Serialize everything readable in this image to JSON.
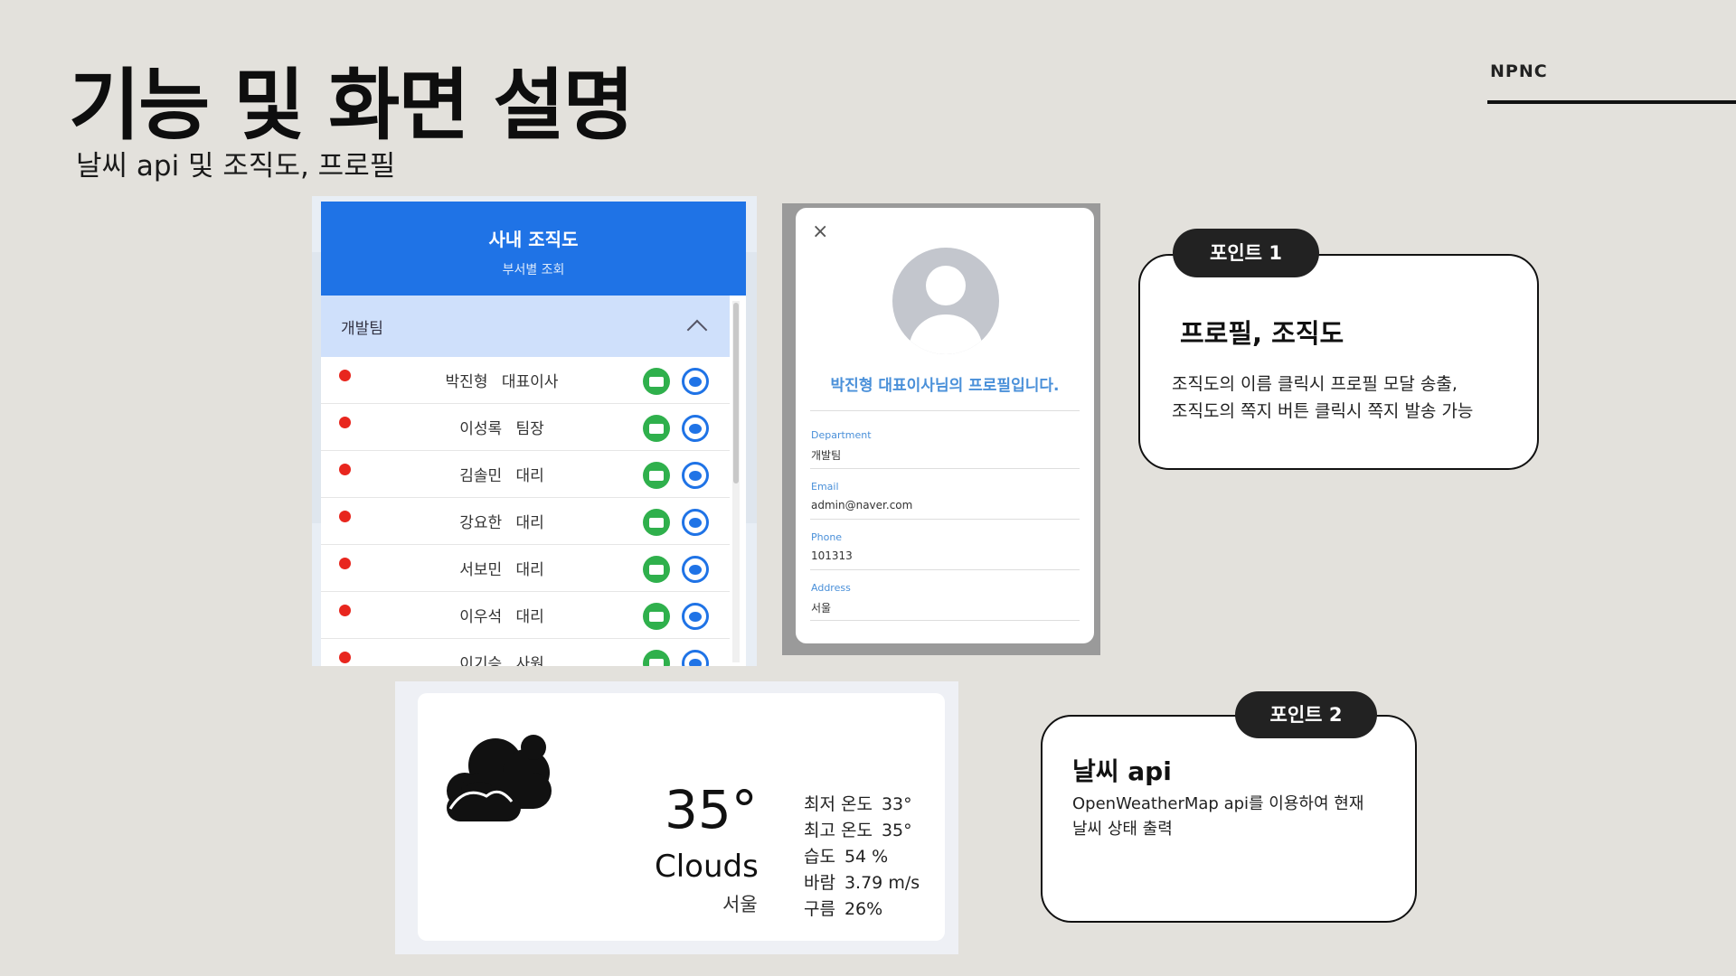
{
  "header": {
    "title": "기능 및 화면 설명",
    "subtitle": "날씨 api 및 조직도, 프로필",
    "brand": "NPNC"
  },
  "org_chart": {
    "title": "사내 조직도",
    "subtitle": "부서별 조회",
    "group_name": "개발팀",
    "members": [
      {
        "name": "박진형",
        "role": "대표이사"
      },
      {
        "name": "이성록",
        "role": "팀장"
      },
      {
        "name": "김솔민",
        "role": "대리"
      },
      {
        "name": "강요한",
        "role": "대리"
      },
      {
        "name": "서보민",
        "role": "대리"
      },
      {
        "name": "이우석",
        "role": "대리"
      },
      {
        "name": "이기승",
        "role": "사원"
      }
    ]
  },
  "profile": {
    "close": "×",
    "heading": "박진형 대표이사님의 프로필입니다.",
    "department_label": "Department",
    "department_value": "개발팀",
    "email_label": "Email",
    "email_value": "admin@naver.com",
    "phone_label": "Phone",
    "phone_value": "101313",
    "address_label": "Address",
    "address_value": "서울"
  },
  "weather": {
    "icon": "cloud-icon",
    "temp": "35°",
    "condition": "Clouds",
    "city": "서울",
    "stats": [
      {
        "label": "최저 온도",
        "value": "33°"
      },
      {
        "label": "최고 온도",
        "value": "35°"
      },
      {
        "label": "습도",
        "value": "54 %"
      },
      {
        "label": "바람",
        "value": "3.79 m/s"
      },
      {
        "label": "구름",
        "value": "26%"
      }
    ]
  },
  "point1": {
    "badge": "포인트 1",
    "title": "프로필, 조직도",
    "desc_line1": "조직도의 이름 클릭시 프로필 모달 송출,",
    "desc_line2": "조직도의 쪽지 버튼 클릭시 쪽지 발송 가능"
  },
  "point2": {
    "badge": "포인트 2",
    "title": "날씨 api",
    "desc": "OpenWeatherMap api를 이용하여 현재 날씨 상태 출력"
  }
}
